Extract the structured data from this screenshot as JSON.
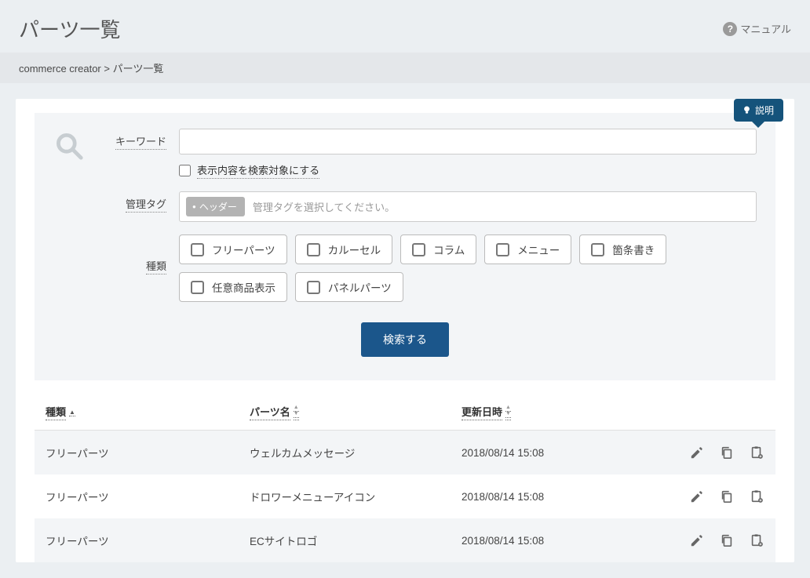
{
  "header": {
    "title": "パーツ一覧",
    "manual": "マニュアル"
  },
  "breadcrumb": {
    "root": "commerce creator",
    "current": "パーツ一覧"
  },
  "badge": {
    "label": "説明"
  },
  "search": {
    "keyword_label": "キーワード",
    "include_content_label": "表示内容を検索対象にする",
    "tag_label": "管理タグ",
    "tag_chip": "ヘッダー",
    "tag_placeholder": "管理タグを選択してください。",
    "type_label": "種類",
    "type_options": [
      "フリーパーツ",
      "カルーセル",
      "コラム",
      "メニュー",
      "箇条書き",
      "任意商品表示",
      "パネルパーツ"
    ],
    "submit": "検索する"
  },
  "table": {
    "cols": {
      "type": "種類",
      "name": "パーツ名",
      "date": "更新日時"
    },
    "rows": [
      {
        "type": "フリーパーツ",
        "name": "ウェルカムメッセージ",
        "date": "2018/08/14 15:08"
      },
      {
        "type": "フリーパーツ",
        "name": "ドロワーメニューアイコン",
        "date": "2018/08/14 15:08"
      },
      {
        "type": "フリーパーツ",
        "name": "ECサイトロゴ",
        "date": "2018/08/14 15:08"
      }
    ]
  }
}
